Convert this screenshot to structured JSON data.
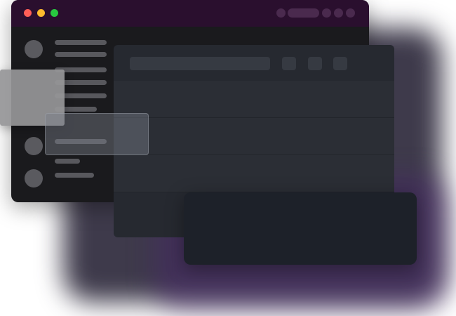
{
  "colors": {
    "titlebar": "#2a0f2e",
    "traffic_close": "#ff5f57",
    "traffic_minimize": "#febc2e",
    "traffic_maximize": "#28c840",
    "window_bg": "#1a1a1d",
    "panel_bg": "#262930",
    "accent_glow": "#46286a"
  },
  "window": {
    "traffic_lights": [
      "close",
      "minimize",
      "maximize"
    ],
    "titlebar_controls": [
      "circle-button",
      "pill-button",
      "circle-button",
      "circle-button",
      "circle-button"
    ]
  },
  "sidebar": {
    "items": [
      "avatar-with-text",
      "text-line",
      "text-line",
      "text-line",
      "text-line",
      "avatar-with-text",
      "avatar-with-text"
    ]
  },
  "main": {
    "toolbar": {
      "search_placeholder": "",
      "buttons": [
        "icon-button",
        "icon-button",
        "icon-button"
      ]
    },
    "rows": 3
  }
}
